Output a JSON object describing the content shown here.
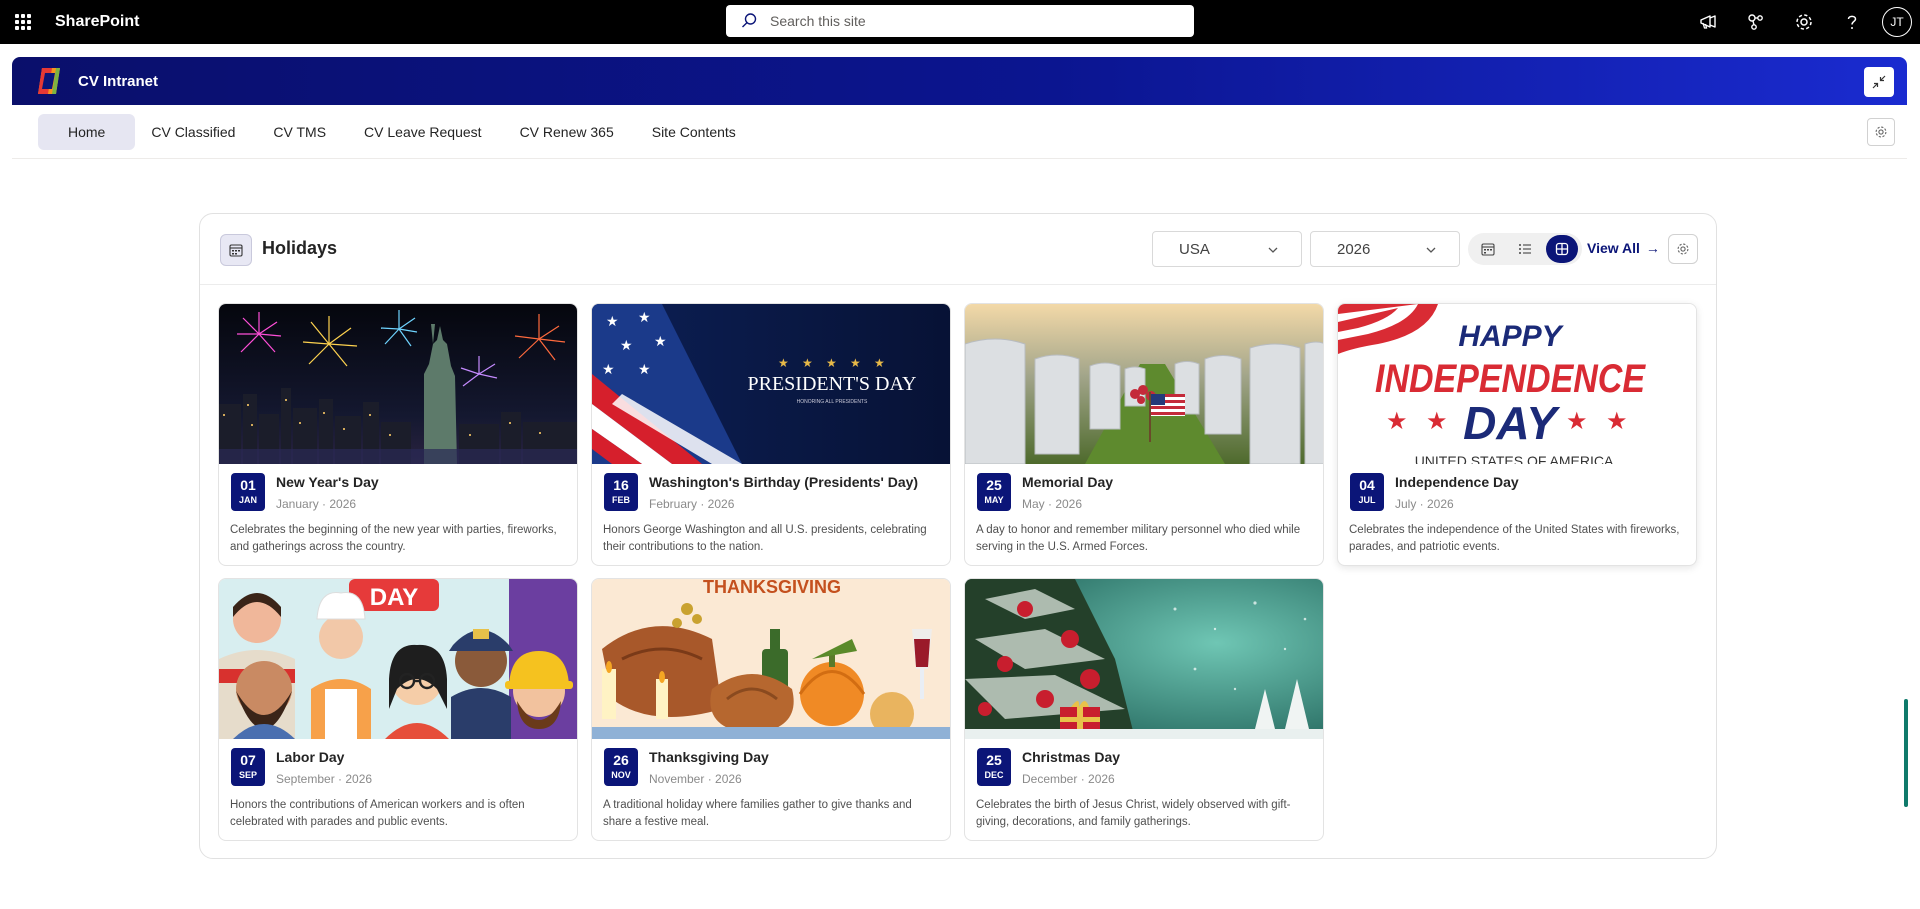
{
  "suitebar": {
    "app_name": "SharePoint",
    "search_placeholder": "Search this site",
    "avatar_initials": "JT"
  },
  "site": {
    "title": "CV Intranet"
  },
  "nav": {
    "items": [
      {
        "label": "Home"
      },
      {
        "label": "CV Classified"
      },
      {
        "label": "CV TMS"
      },
      {
        "label": "CV Leave Request"
      },
      {
        "label": "CV Renew 365"
      },
      {
        "label": "Site Contents"
      }
    ],
    "active": "Home"
  },
  "holidays": {
    "title": "Holidays",
    "country": "USA",
    "year": "2026",
    "view_all_label": "View All",
    "view_mode": "grid",
    "cards": [
      {
        "day": "01",
        "mon": "JAN",
        "title": "New Year's Day",
        "sub": "January · 2026",
        "desc": "Celebrates the beginning of the new year with parties, fireworks, and gatherings across the country."
      },
      {
        "day": "16",
        "mon": "FEB",
        "title": "Washington's Birthday (Presidents' Day)",
        "sub": "February · 2026",
        "desc": "Honors George Washington and all U.S. presidents, celebrating their contributions to the nation.",
        "img_text": "PRESIDENT'S DAY",
        "img_subtext": "HONORING ALL PRESIDENTS"
      },
      {
        "day": "25",
        "mon": "MAY",
        "title": "Memorial Day",
        "sub": "May · 2026",
        "desc": "A day to honor and remember military personnel who died while serving in the U.S. Armed Forces."
      },
      {
        "day": "04",
        "mon": "JUL",
        "title": "Independence Day",
        "sub": "July · 2026",
        "desc": "Celebrates the independence of the United States with fireworks, parades, and patriotic events.",
        "img_text_1": "HAPPY",
        "img_text_2": "INDEPENDENCE",
        "img_text_3": "DAY",
        "img_text_4": "UNITED STATES OF AMERICA"
      },
      {
        "day": "07",
        "mon": "SEP",
        "title": "Labor Day",
        "sub": "September · 2026",
        "desc": "Honors the contributions of American workers and is often celebrated with parades and public events.",
        "img_text": "DAY"
      },
      {
        "day": "26",
        "mon": "NOV",
        "title": "Thanksgiving Day",
        "sub": "November · 2026",
        "desc": "A traditional holiday where families gather to give thanks and share a festive meal.",
        "img_text": "THANKSGIVING"
      },
      {
        "day": "25",
        "mon": "DEC",
        "title": "Christmas Day",
        "sub": "December · 2026",
        "desc": "Celebrates the birth of Jesus Christ, widely observed with gift-giving, decorations, and family gatherings."
      }
    ]
  },
  "colors": {
    "brand_navy": "#0b1578",
    "header_gradient_start": "#0a0f6b",
    "header_gradient_end": "#1a2bd0",
    "suitebar": "#000000"
  }
}
